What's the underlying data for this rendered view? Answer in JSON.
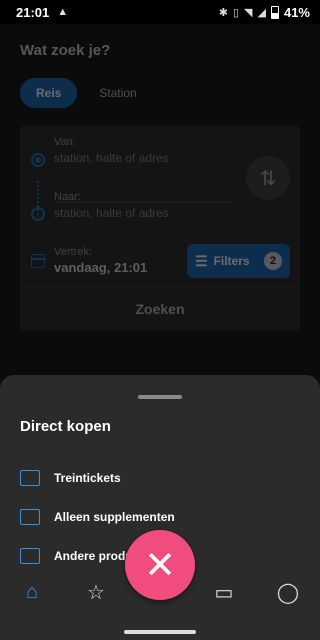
{
  "status": {
    "time": "21:01",
    "battery": "41%"
  },
  "search": {
    "title": "Wat zoek je?",
    "tabs": [
      "Reis",
      "Station"
    ],
    "from_label": "Van:",
    "from_placeholder": "station, halte of adres",
    "to_label": "Naar:",
    "to_placeholder": "station, halte of adres",
    "depart_label": "Vertrek:",
    "depart_value": "vandaag, 21:01",
    "filters_label": "Filters",
    "filters_count": "2",
    "search_button": "Zoeken"
  },
  "sheet": {
    "title": "Direct kopen",
    "items": [
      {
        "label": "Treintickets",
        "icon": "ticket-icon"
      },
      {
        "label": "Alleen supplementen",
        "icon": "supplement-list-icon"
      },
      {
        "label": "Andere producten",
        "icon": "products-icon"
      }
    ]
  },
  "nav": {
    "items": [
      {
        "icon": "home-icon"
      },
      {
        "icon": "star-icon"
      },
      {
        "icon": "ticket-icon"
      },
      {
        "icon": "profile-icon"
      }
    ]
  },
  "fab": {
    "icon": "close-icon"
  },
  "colors": {
    "accent": "#1e6fb6",
    "fab": "#f14c7e",
    "sheet": "#2b2b2b"
  }
}
